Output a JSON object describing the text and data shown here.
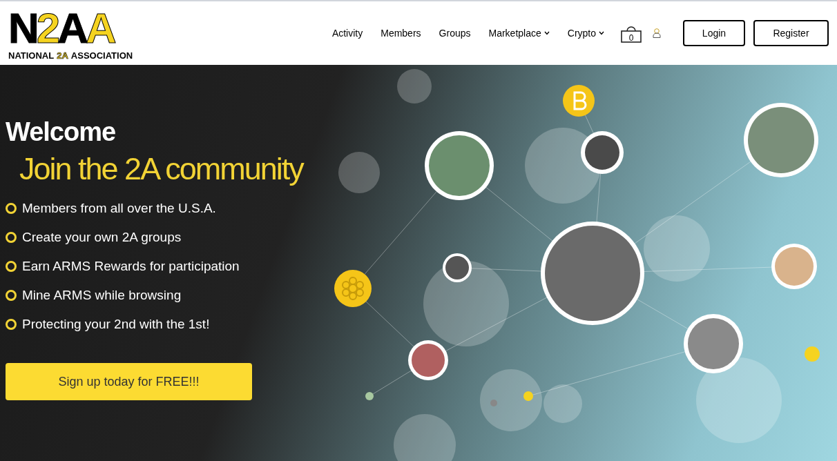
{
  "logo": {
    "mark": "N2AA",
    "tagline": [
      "NATIONAL",
      "2A",
      "ASSOCIATION"
    ]
  },
  "nav": [
    {
      "label": "Activity",
      "dropdown": false
    },
    {
      "label": "Members",
      "dropdown": false
    },
    {
      "label": "Groups",
      "dropdown": false
    },
    {
      "label": "Marketplace",
      "dropdown": true
    },
    {
      "label": "Crypto",
      "dropdown": true
    }
  ],
  "cart": {
    "count": "0"
  },
  "buttons": [
    "Login",
    "Register"
  ],
  "hero": {
    "title": "Welcome",
    "subtitle": "Join the 2A community",
    "features": [
      "Members from all over the U.S.A.",
      "Create your own 2A groups",
      "Earn ARMS Rewards for participation",
      "Mine ARMS while browsing",
      "Protecting your 2nd with the 1st!"
    ],
    "cta": "Sign up today for FREE!!!"
  }
}
